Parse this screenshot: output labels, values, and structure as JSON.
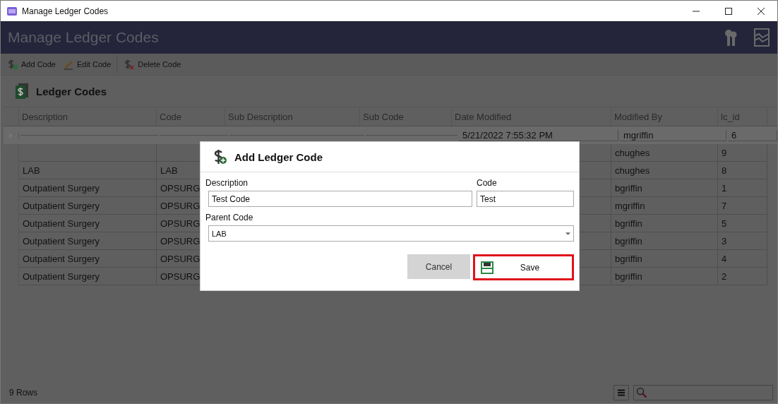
{
  "window": {
    "title": "Manage Ledger Codes"
  },
  "header": {
    "title": "Manage Ledger Codes"
  },
  "toolbar": [
    "Add Code",
    "Edit Code",
    "Delete Code"
  ],
  "section": {
    "title": "Ledger Codes"
  },
  "table": {
    "columns": [
      "Description",
      "Code",
      "Sub Description",
      "Sub Code",
      "Date Modified",
      "Modified By",
      "lc_id"
    ],
    "rows": [
      {
        "selected": true,
        "date_modified": "5/21/2022 7:55:32 PM",
        "modified_by": "mgriffin",
        "lc_id": "6"
      },
      {
        "selected": false,
        "modified_by": "chughes",
        "lc_id": "9"
      },
      {
        "selected": false,
        "description": "LAB",
        "code": "LAB",
        "modified_by": "chughes",
        "lc_id": "8"
      },
      {
        "selected": false,
        "description": "Outpatient Surgery",
        "code": "OPSURG",
        "modified_by": "bgriffin",
        "lc_id": "1"
      },
      {
        "selected": false,
        "description": "Outpatient Surgery",
        "code": "OPSURG",
        "modified_by": "mgriffin",
        "lc_id": "7"
      },
      {
        "selected": false,
        "description": "Outpatient Surgery",
        "code": "OPSURG",
        "modified_by": "bgriffin",
        "lc_id": "5"
      },
      {
        "selected": false,
        "description": "Outpatient Surgery",
        "code": "OPSURG",
        "modified_by": "bgriffin",
        "lc_id": "3"
      },
      {
        "selected": false,
        "description": "Outpatient Surgery",
        "code": "OPSURG",
        "modified_by": "bgriffin",
        "lc_id": "4"
      },
      {
        "selected": false,
        "description": "Outpatient Surgery",
        "code": "OPSURG",
        "modified_by": "bgriffin",
        "lc_id": "2"
      }
    ]
  },
  "status_bar": {
    "row_count": "9 Rows"
  },
  "dialog": {
    "title": "Add Ledger Code",
    "description_label": "Description",
    "description_value": "Test Code",
    "code_label": "Code",
    "code_value": "Test",
    "parent_label": "Parent Code",
    "parent_value": "LAB",
    "cancel": "Cancel",
    "save": "Save"
  }
}
